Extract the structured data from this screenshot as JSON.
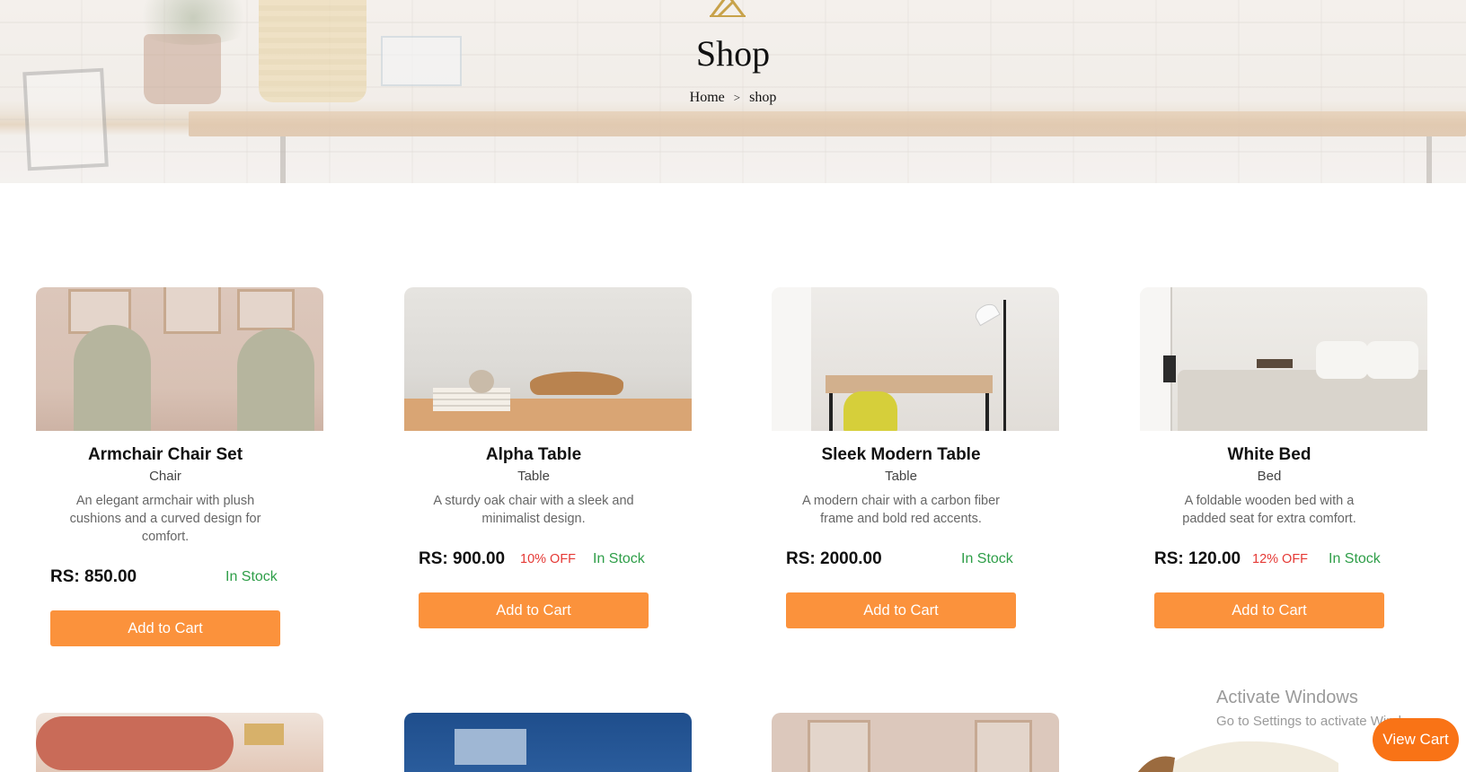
{
  "hero": {
    "title": "Shop",
    "breadcrumb": {
      "home": "Home",
      "separator": ">",
      "current": "shop"
    }
  },
  "products": [
    {
      "name": "Armchair Chair Set",
      "category": "Chair",
      "description": "An elegant armchair with plush cushions and a curved design for comfort.",
      "price": "RS: 850.00",
      "discount": "",
      "stock": "In Stock",
      "button": "Add to Cart"
    },
    {
      "name": "Alpha Table",
      "category": "Table",
      "description": "A sturdy oak chair with a sleek and minimalist design.",
      "price": "RS: 900.00",
      "discount": "10% OFF",
      "stock": "In Stock",
      "button": "Add to Cart"
    },
    {
      "name": "Sleek Modern Table",
      "category": "Table",
      "description": "A modern chair with a carbon fiber frame and bold red accents.",
      "price": "RS: 2000.00",
      "discount": "",
      "stock": "In Stock",
      "button": "Add to Cart"
    },
    {
      "name": "White Bed",
      "category": "Bed",
      "description": "A foldable wooden bed with a padded seat for extra comfort.",
      "price": "RS: 120.00",
      "discount": "12% OFF",
      "stock": "In Stock",
      "button": "Add to Cart"
    }
  ],
  "watermark": {
    "line1": "Activate Windows",
    "line2": "Go to Settings to activate Windows."
  },
  "view_cart": "View Cart",
  "colors": {
    "accent": "#fb923c",
    "view_cart": "#f97316",
    "in_stock": "#2e9e48",
    "discount": "#e53935",
    "logo_gold": "#c8a24a"
  }
}
